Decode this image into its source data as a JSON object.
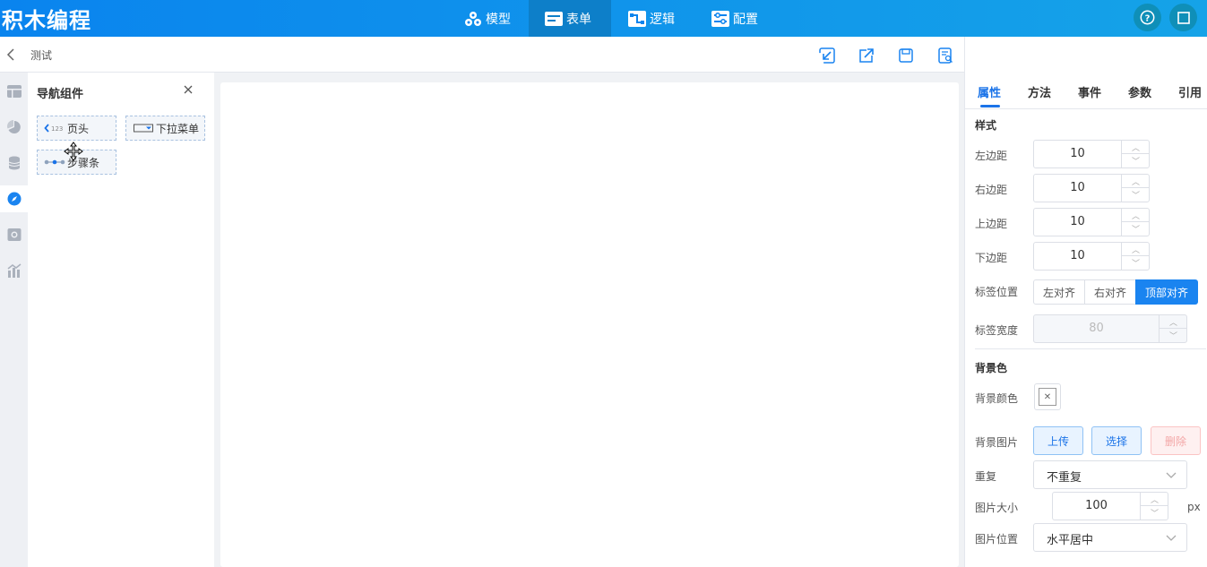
{
  "app": {
    "logo": "积木编程"
  },
  "nav": {
    "tabs": [
      {
        "label": "模型",
        "icon": "model-icon"
      },
      {
        "label": "表单",
        "icon": "form-icon",
        "active": true
      },
      {
        "label": "逻辑",
        "icon": "logic-icon"
      },
      {
        "label": "配置",
        "icon": "config-icon"
      }
    ],
    "help_icon": "help-icon",
    "fullscreen_icon": "fullscreen-icon"
  },
  "subbar": {
    "title": "测试",
    "tools": [
      "import-icon",
      "export-icon",
      "save-icon",
      "preview-icon"
    ]
  },
  "rail": {
    "items": [
      "layout-icon",
      "chart-icon",
      "database-icon",
      "navigation-icon",
      "media-icon",
      "statistics-icon"
    ],
    "active_index": 3
  },
  "panel": {
    "title": "导航组件",
    "components": [
      {
        "label": "页头",
        "icon_text": "123"
      },
      {
        "label": "下拉菜单"
      },
      {
        "label": "步骤条"
      }
    ]
  },
  "props": {
    "tabs": [
      "属性",
      "方法",
      "事件",
      "参数",
      "引用"
    ],
    "style_section": "样式",
    "fields": [
      {
        "label": "左边距",
        "value": "10"
      },
      {
        "label": "右边距",
        "value": "10"
      },
      {
        "label": "上边距",
        "value": "10"
      },
      {
        "label": "下边距",
        "value": "10"
      }
    ],
    "label_position": {
      "label": "标签位置",
      "options": [
        "左对齐",
        "右对齐",
        "顶部对齐"
      ],
      "selected": "顶部对齐"
    },
    "label_width": {
      "label": "标签宽度",
      "value": "80"
    },
    "bg_section": "背景色",
    "bg_color_label": "背景颜色",
    "bg_image_label": "背景图片",
    "upload": "上传",
    "choose": "选择",
    "delete": "删除",
    "repeat": {
      "label": "重复",
      "value": "不重复"
    },
    "image_size": {
      "label": "图片大小",
      "value": "100",
      "unit": "px"
    },
    "image_position": {
      "label": "图片位置",
      "value": "水平居中"
    }
  },
  "colors": {
    "accent": "#1a84f0",
    "topbar": "#0a84ee"
  }
}
